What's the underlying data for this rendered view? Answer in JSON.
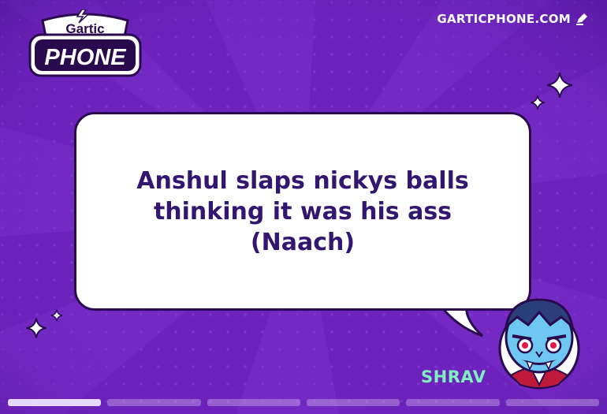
{
  "header": {
    "logo_top": "Gartic",
    "logo_bottom": "PHONE",
    "site": "GARTICPHONE.COM"
  },
  "message": {
    "line1": "Anshul slaps nickys balls",
    "line2": "thinking it was his ass",
    "line3": "(Naach)"
  },
  "player": {
    "name": "SHRAV"
  },
  "progress": {
    "segments": 6,
    "current": 1
  },
  "colors": {
    "background": "#6a1fb8",
    "text": "#33166f",
    "player_name": "#7ff0c0",
    "bubble_border": "#2a0a4f"
  },
  "icons": [
    "logo",
    "edit-icon",
    "sparkle-icon",
    "vampire-avatar"
  ]
}
